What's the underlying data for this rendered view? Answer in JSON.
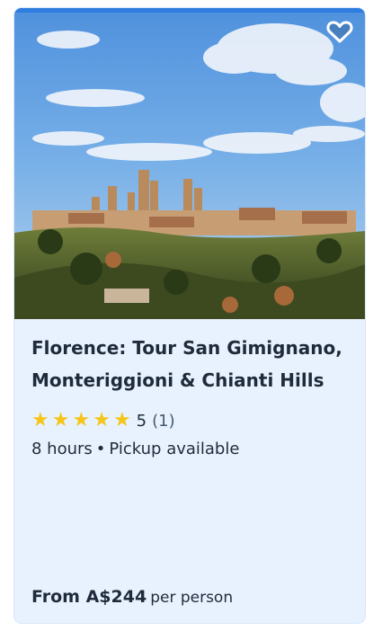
{
  "card": {
    "image_alt": "San Gimignano skyline",
    "title": "Florence: Tour San Gimignano, Monteriggioni & Chianti Hills",
    "rating": {
      "value": 5,
      "score_label": "5",
      "count_label": "(1)"
    },
    "duration": "8 hours",
    "separator": "•",
    "pickup": "Pickup available",
    "price": {
      "from_label": "From A$244",
      "per_label": "per person"
    },
    "colors": {
      "background": "#e8f2ff",
      "title": "#1f2b3a",
      "star": "#f5c518",
      "top_bar": "#2f7de1"
    },
    "icons": {
      "favorite": "heart-icon",
      "star": "star-icon"
    }
  }
}
